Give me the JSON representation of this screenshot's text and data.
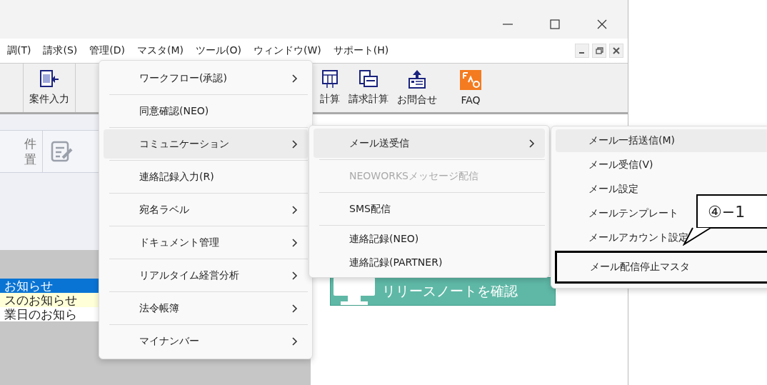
{
  "menu_bar": [
    {
      "label": "調(T)"
    },
    {
      "label": "請求(S)"
    },
    {
      "label": "管理(D)"
    },
    {
      "label": "マスタ(M)"
    },
    {
      "label": "ツール(O)"
    },
    {
      "label": "ウィンドウ(W)"
    },
    {
      "label": "サポート(H)"
    }
  ],
  "toolbar": [
    {
      "label": "案件入力",
      "kind": "case"
    },
    {
      "label": "計算",
      "kind": "calc"
    },
    {
      "label": "請求計算",
      "kind": "bill"
    },
    {
      "label": "お問合せ",
      "kind": "inquiry"
    },
    {
      "label": "FAQ",
      "kind": "faq"
    }
  ],
  "side_panel": {
    "buttons": [
      {
        "label": "件",
        "label_2": "置"
      }
    ]
  },
  "notices": [
    {
      "text": "お知らせ",
      "selected": true,
      "kind": "plain"
    },
    {
      "text": "スのお知らせ",
      "selected": false,
      "kind": "highlighted"
    },
    {
      "text": "業日のお知ら",
      "selected": false,
      "kind": "plain"
    }
  ],
  "banner": {
    "label": "リリースノートを確認"
  },
  "menu": [
    {
      "label": "ワークフロー(承認)",
      "submenu": true,
      "selected": false
    },
    {
      "label": "同意確認(NEO)",
      "submenu": false,
      "selected": false
    },
    {
      "label": "コミュニケーション",
      "submenu": true,
      "selected": true
    },
    {
      "label": "連絡記録入力(R)",
      "submenu": false,
      "selected": false
    },
    {
      "label": "宛名ラベル",
      "submenu": true,
      "selected": false
    },
    {
      "label": "ドキュメント管理",
      "submenu": true,
      "selected": false
    },
    {
      "label": "リアルタイム経営分析",
      "submenu": true,
      "selected": false
    },
    {
      "label": "法令帳簿",
      "submenu": true,
      "selected": false
    },
    {
      "label": "マイナンバー",
      "submenu": true,
      "selected": false
    }
  ],
  "submenu": [
    {
      "label": "メール送受信",
      "submenu": true,
      "selected": true,
      "disabled": false,
      "separator_after": true
    },
    {
      "label": "NEOWORKSメッセージ配信",
      "submenu": false,
      "selected": false,
      "disabled": true,
      "separator_after": true
    },
    {
      "label": "SMS配信",
      "submenu": false,
      "selected": false,
      "disabled": false,
      "separator_after": true
    },
    {
      "label": "連絡記録(NEO)",
      "submenu": false,
      "selected": false,
      "disabled": false,
      "separator_after": false
    },
    {
      "label": "連絡記録(PARTNER)",
      "submenu": false,
      "selected": false,
      "disabled": false,
      "separator_after": false
    }
  ],
  "submenu_2": [
    {
      "label": "メール一括送信(M)",
      "selected": true,
      "annotated": false
    },
    {
      "label": "メール受信(V)",
      "selected": false,
      "annotated": false
    },
    {
      "label": "メール設定",
      "selected": false,
      "annotated": false
    },
    {
      "label": "メールテンプレート",
      "selected": false,
      "annotated": false
    },
    {
      "label": "メールアカウント設定",
      "selected": false,
      "annotated": false
    },
    {
      "label": "メール配信停止マスタ",
      "selected": false,
      "annotated": true
    }
  ],
  "callout": {
    "label": "④−1"
  }
}
